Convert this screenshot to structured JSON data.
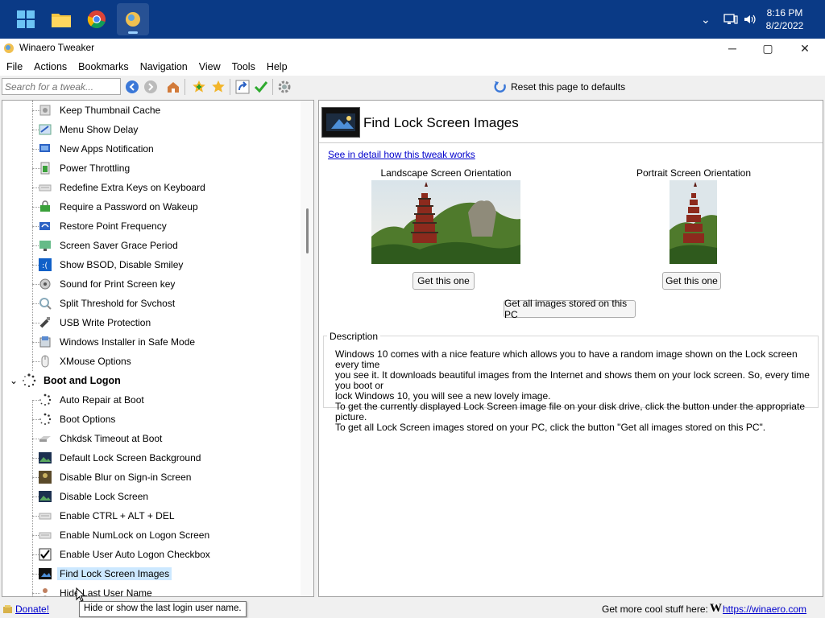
{
  "taskbar": {
    "time": "8:16 PM",
    "date": "8/2/2022"
  },
  "window": {
    "title": "Winaero Tweaker",
    "minimize": "─",
    "maximize": "▢",
    "close": "✕"
  },
  "menu": [
    "File",
    "Actions",
    "Bookmarks",
    "Navigation",
    "View",
    "Tools",
    "Help"
  ],
  "toolbar": {
    "search_placeholder": "Search for a tweak...",
    "reset_label": "Reset this page to defaults"
  },
  "tree": {
    "items_above": [
      {
        "label": "Keep Thumbnail Cache",
        "icon": "thumbnail-icon"
      },
      {
        "label": "Menu Show Delay",
        "icon": "menu-delay-icon"
      },
      {
        "label": "New Apps Notification",
        "icon": "notification-icon"
      },
      {
        "label": "Power Throttling",
        "icon": "power-icon"
      },
      {
        "label": "Redefine Extra Keys on Keyboard",
        "icon": "keyboard-icon"
      },
      {
        "label": "Require a Password on Wakeup",
        "icon": "password-icon"
      },
      {
        "label": "Restore Point Frequency",
        "icon": "restore-icon"
      },
      {
        "label": "Screen Saver Grace Period",
        "icon": "screensaver-icon"
      },
      {
        "label": "Show BSOD, Disable Smiley",
        "icon": "bsod-icon"
      },
      {
        "label": "Sound for Print Screen key",
        "icon": "sound-icon"
      },
      {
        "label": "Split Threshold for Svchost",
        "icon": "svchost-icon"
      },
      {
        "label": "USB Write Protection",
        "icon": "usb-icon"
      },
      {
        "label": "Windows Installer in Safe Mode",
        "icon": "installer-icon"
      },
      {
        "label": "XMouse Options",
        "icon": "mouse-icon"
      }
    ],
    "category": {
      "label": "Boot and Logon",
      "icon": "boot-icon",
      "expander": "⌄"
    },
    "items_below": [
      {
        "label": "Auto Repair at Boot",
        "icon": "spinner-icon"
      },
      {
        "label": "Boot Options",
        "icon": "spinner-icon"
      },
      {
        "label": "Chkdsk Timeout at Boot",
        "icon": "disk-icon"
      },
      {
        "label": "Default Lock Screen Background",
        "icon": "landscape-icon"
      },
      {
        "label": "Disable Blur on Sign-in Screen",
        "icon": "blur-icon"
      },
      {
        "label": "Disable Lock Screen",
        "icon": "landscape-icon"
      },
      {
        "label": "Enable CTRL + ALT + DEL",
        "icon": "keyboard-icon"
      },
      {
        "label": "Enable NumLock on Logon Screen",
        "icon": "keyboard-icon"
      },
      {
        "label": "Enable User Auto Logon Checkbox",
        "icon": "checkbox-icon"
      },
      {
        "label": "Find Lock Screen Images",
        "icon": "lockscreen-icon"
      },
      {
        "label": "Hide Last User Name",
        "icon": "user-icon"
      }
    ]
  },
  "content": {
    "title": "Find Lock Screen Images",
    "detail_link": "See in detail how this tweak works",
    "landscape_label": "Landscape Screen Orientation",
    "portrait_label": "Portrait Screen Orientation",
    "get_this_one": "Get this one",
    "get_all": "Get all images stored on this PC",
    "description_legend": "Description",
    "description_lines": [
      "Windows 10 comes with a nice feature which allows you to have a random image shown on the Lock screen every time",
      "you see it. It downloads beautiful images from the Internet and shows them on your lock screen. So, every time you boot or",
      "lock Windows 10, you will see a new lovely image.",
      "To get the currently displayed Lock Screen image file on your disk drive, click the button under the appropriate picture.",
      "To get all Lock Screen images stored on your PC, click the button \"Get all images stored on this PC\"."
    ]
  },
  "statusbar": {
    "donate": "Donate!",
    "more": "Get more cool stuff here:",
    "logo": "W",
    "link": "https://winaero.com"
  },
  "tooltip": "Hide or show the last login user name."
}
